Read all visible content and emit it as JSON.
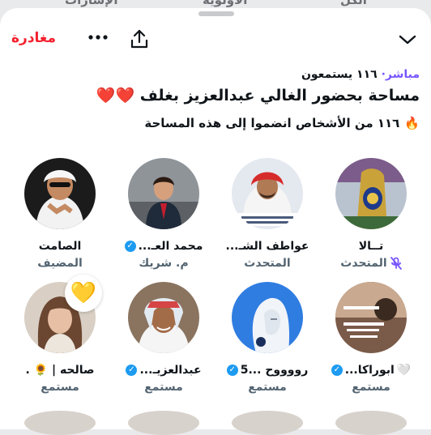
{
  "background_tabs": [
    "الكل",
    "الأولوية",
    "الإشارات"
  ],
  "header": {
    "leave_label": "مغادرة",
    "more_icon": "more-horizontal-icon",
    "share_icon": "share-icon",
    "collapse_icon": "chevron-down-icon"
  },
  "space": {
    "live_label": "مباشر·",
    "listeners_text": "١١٦ يستمعون",
    "title": "مساحة بحضور الغالي عبدالعزيز بغلف ❤️❤️",
    "joined_icon": "🔥",
    "joined_text": "١١٦ من الأشخاص انضموا إلى هذه المساحة"
  },
  "participants": [
    {
      "name": "الصامت",
      "role": "المضيف",
      "verified": false,
      "muted": false
    },
    {
      "name": "محمد العـ...",
      "role": "م. شريك",
      "verified": true,
      "muted": false
    },
    {
      "name": "عواطف الشـ...",
      "role": "المتحدث",
      "verified": false,
      "muted": false
    },
    {
      "name": "تــالا",
      "role": "المتحدث",
      "verified": false,
      "muted": true
    },
    {
      "name": "صالحه | 🌻 .",
      "role": "مستمع",
      "verified": false,
      "muted": false,
      "reaction": "💛"
    },
    {
      "name": "عبدالعزيـ...",
      "role": "مستمع",
      "verified": true,
      "muted": false
    },
    {
      "name": "رووووح ...5",
      "role": "مستمع",
      "verified": true,
      "muted": false
    },
    {
      "name": "ابوراكا...",
      "role": "مستمع",
      "verified": true,
      "muted": false,
      "suffix": "🤍"
    }
  ],
  "colors": {
    "accent_red": "#f4212e",
    "live_purple": "#7856ff",
    "verified_blue": "#1d9bf0",
    "secondary_text": "#536471"
  }
}
